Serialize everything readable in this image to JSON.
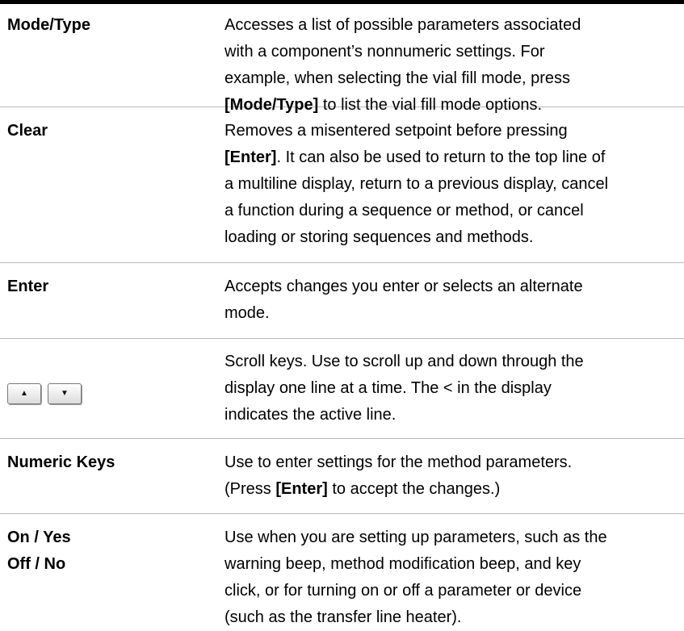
{
  "rows": [
    {
      "key": "Mode/Type",
      "desc": {
        "l1": "Accesses a list of possible parameters associated",
        "l2": "with a component’s nonnumeric settings. For",
        "l3": "example, when selecting the vial fill mode, press",
        "l4_pre": "",
        "l4_key": "[Mode/Type]",
        "l4_post": " to list the vial fill mode options."
      }
    },
    {
      "key": "Clear",
      "desc": {
        "l1": "Removes a misentered setpoint before pressing",
        "l2_key": "[Enter]",
        "l2_post": ". It can also be used to return to the top line of",
        "l3": "a multiline display, return to a previous display, cancel",
        "l4": "a function during a sequence or method, or cancel",
        "l5": "loading or storing sequences and methods."
      }
    },
    {
      "key": "Enter",
      "desc": {
        "l1": "Accepts changes you enter or selects an alternate",
        "l2": "mode."
      }
    },
    {
      "key_icons": [
        "up-arrow-icon",
        "down-arrow-icon"
      ],
      "key_glyphs": [
        "▲",
        "▼"
      ],
      "desc": {
        "l1": "Scroll keys. Use to scroll up and down through the",
        "l2": "display one line at a time. The < in the display",
        "l3": "indicates the active line."
      }
    },
    {
      "key": "Numeric Keys",
      "desc": {
        "l1": "Use to enter settings for the method parameters.",
        "l2_pre": "(Press ",
        "l2_key": "[Enter]",
        "l2_post": " to accept the changes.)"
      }
    },
    {
      "key_l1": "On / Yes",
      "key_l2": "Off / No",
      "desc": {
        "l1": "Use when you are setting up parameters, such as the",
        "l2": "warning beep, method modification beep, and key",
        "l3": "click, or for turning on or off a parameter or device",
        "l4": "(such as the transfer line heater)."
      }
    }
  ]
}
